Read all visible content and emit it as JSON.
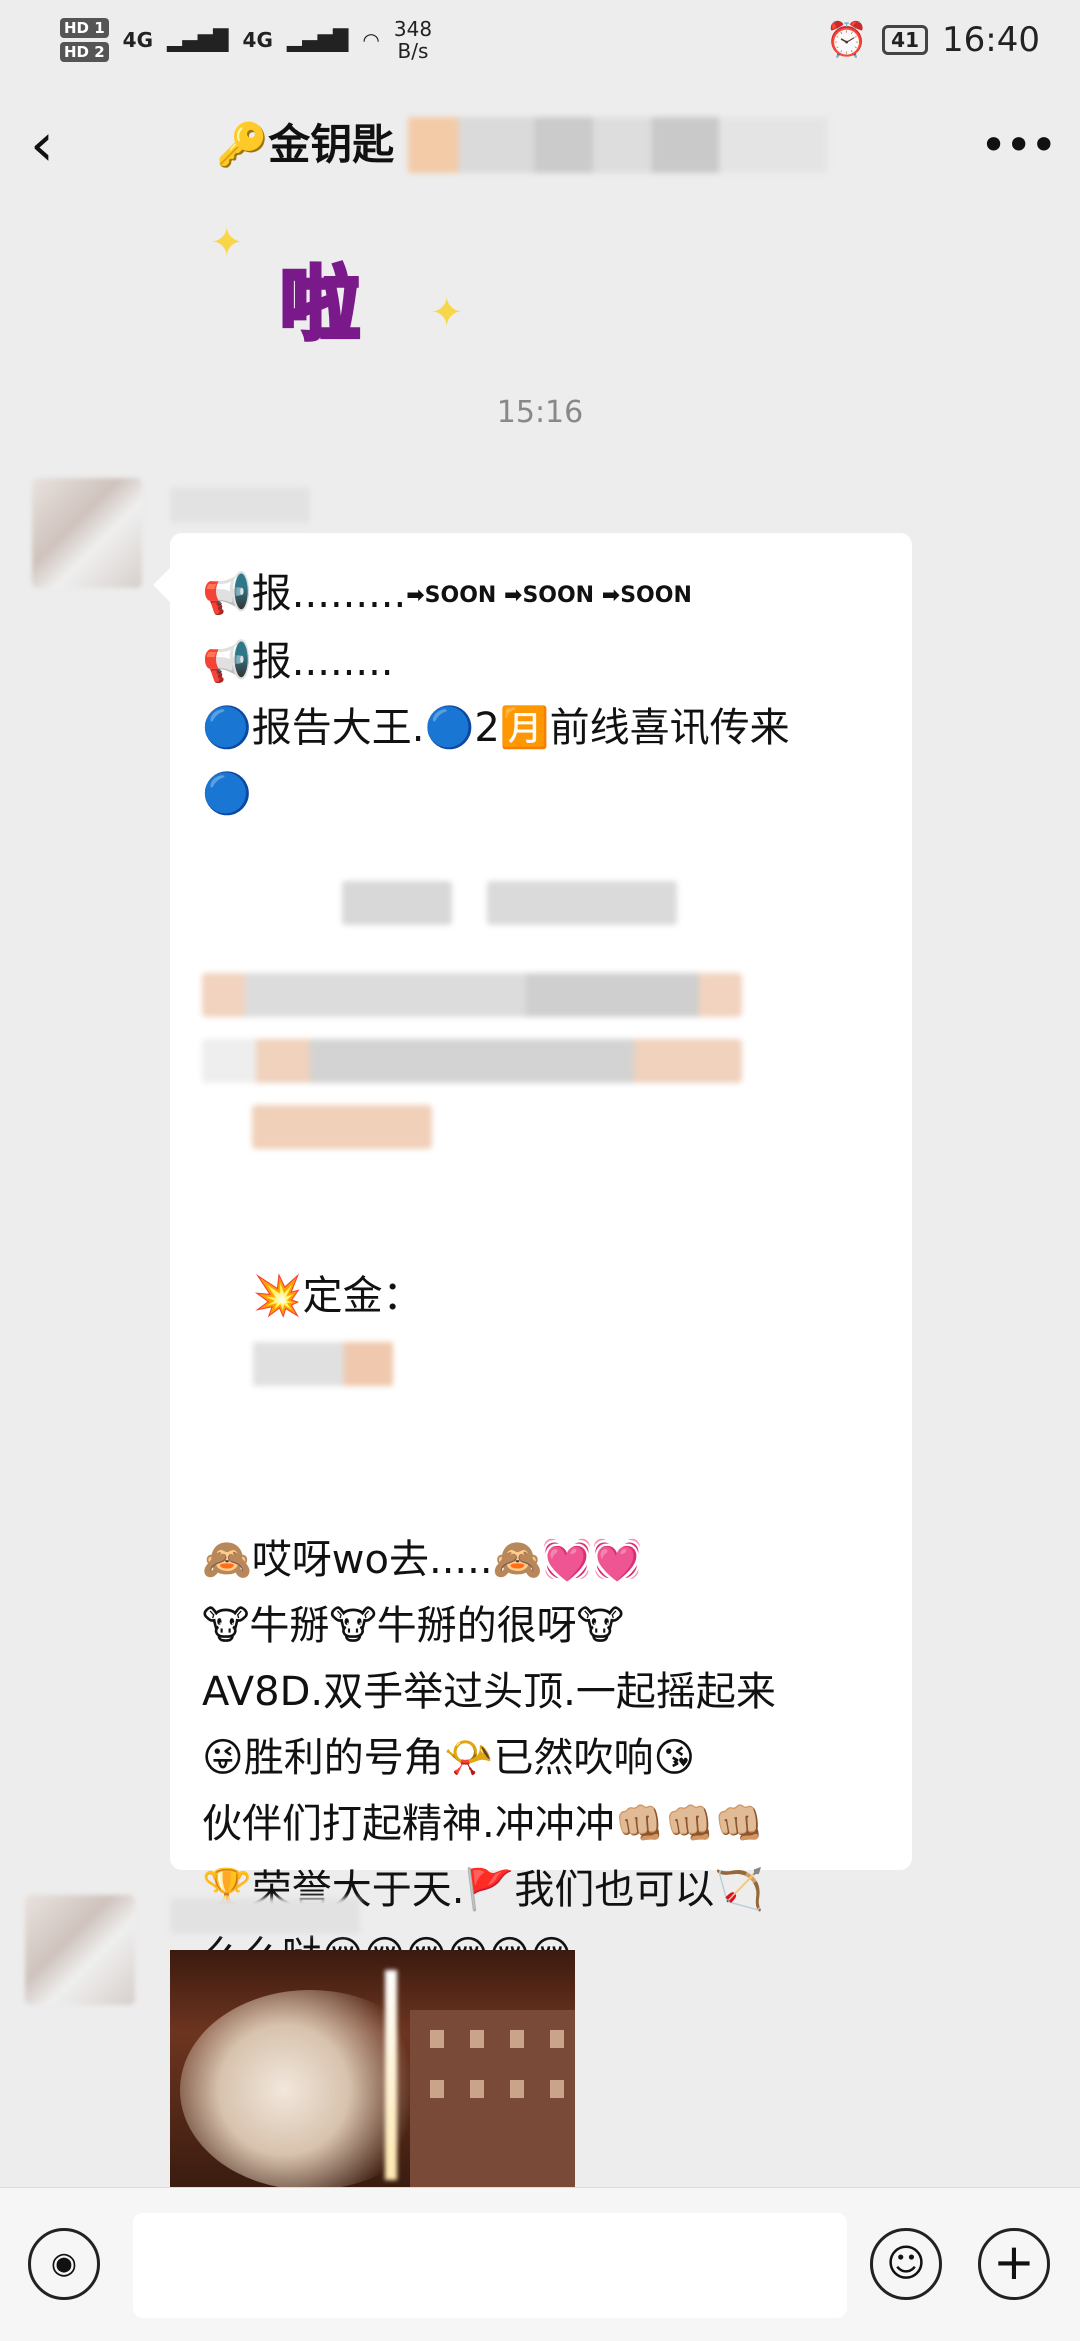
{
  "status_bar": {
    "hd1": "HD 1",
    "hd2": "HD 2",
    "net1": "4G",
    "net2": "4G",
    "speed_value": "348",
    "speed_unit": "B/s",
    "battery": "41",
    "time": "16:40"
  },
  "header": {
    "back_icon": "chevron-left-icon",
    "title": "🔑金钥匙",
    "more_icon": "ellipsis-icon",
    "more_label": "•••"
  },
  "sticker": {
    "text": "啦"
  },
  "timestamp": "15:16",
  "message": {
    "lines": [
      "📢报.........",
      "📢报........",
      "🔵报告大王.🔵2🈷️前线喜讯传来",
      "🔵",
      "💥定金：",
      "🙈哎呀wo去.....🙈💓💓",
      "🐮牛掰🐮牛掰的很呀🐮",
      "AV8D.双手举过头顶.一起摇起来",
      "😜胜利的号角📯已然吹响😘",
      "伙伴们打起精神.冲冲冲👊🏼👊🏼👊🏼",
      "🏆荣誉大于天.🚩我们也可以🏹",
      "么么哒😚😚😚😚😚😚"
    ],
    "soon_arrows": "➡SOON ➡SOON ➡SOON",
    "blurred_fragment": "部"
  },
  "input_bar": {
    "voice_icon": "voice-icon",
    "emoji_icon": "emoji-icon",
    "plus_icon": "plus-icon"
  }
}
